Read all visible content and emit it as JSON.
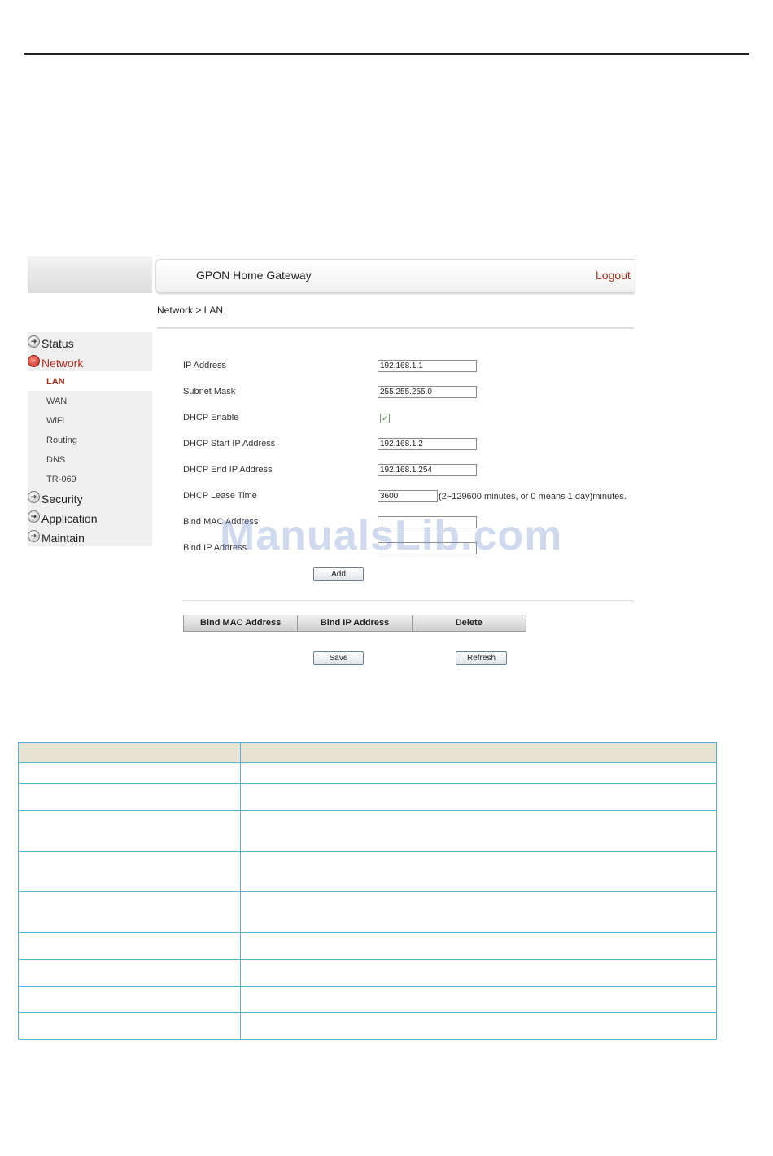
{
  "header": {
    "title": "GPON Home Gateway",
    "logout_label": "Logout"
  },
  "breadcrumb": "Network > LAN",
  "nav": {
    "status": "Status",
    "network": "Network",
    "network_items": [
      "LAN",
      "WAN",
      "WiFi",
      "Routing",
      "DNS",
      "TR-069"
    ],
    "security": "Security",
    "application": "Application",
    "maintain": "Maintain"
  },
  "form": {
    "ip_address": {
      "label": "IP Address",
      "value": "192.168.1.1"
    },
    "subnet_mask": {
      "label": "Subnet Mask",
      "value": "255.255.255.0"
    },
    "dhcp_enable": {
      "label": "DHCP Enable",
      "checked": true
    },
    "dhcp_start": {
      "label": "DHCP Start IP Address",
      "value": "192.168.1.2"
    },
    "dhcp_end": {
      "label": "DHCP End IP Address",
      "value": "192.168.1.254"
    },
    "lease_time": {
      "label": "DHCP Lease Time",
      "value": "3600",
      "hint": "(2~129600 minutes, or 0 means 1 day)minutes."
    },
    "bind_mac": {
      "label": "Bind MAC Address",
      "value": ""
    },
    "bind_ip": {
      "label": "Bind IP Address",
      "value": ""
    },
    "add_label": "Add"
  },
  "bind_table": {
    "columns": [
      "Bind MAC Address",
      "Bind IP Address",
      "Delete"
    ]
  },
  "actions": {
    "save_label": "Save",
    "refresh_label": "Refresh"
  },
  "watermark": "ManualsLib.com",
  "colors": {
    "accent_red": "#b22b1c",
    "table_border": "#5ab0d6",
    "table_header_bg": "#e8e2d2"
  }
}
